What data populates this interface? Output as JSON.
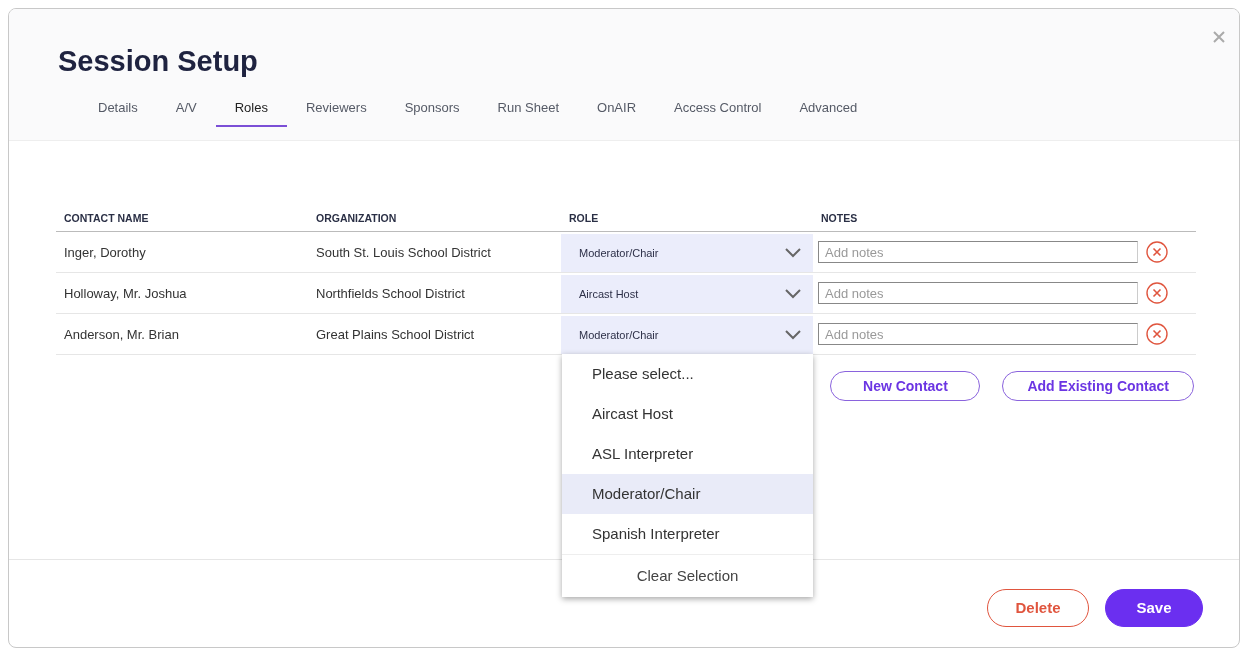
{
  "dialog": {
    "title": "Session Setup"
  },
  "tabs": [
    {
      "label": "Details",
      "selected": false
    },
    {
      "label": "A/V",
      "selected": false
    },
    {
      "label": "Roles",
      "selected": true
    },
    {
      "label": "Reviewers",
      "selected": false
    },
    {
      "label": "Sponsors",
      "selected": false
    },
    {
      "label": "Run Sheet",
      "selected": false
    },
    {
      "label": "OnAIR",
      "selected": false
    },
    {
      "label": "Access Control",
      "selected": false
    },
    {
      "label": "Advanced",
      "selected": false
    }
  ],
  "table": {
    "columns": [
      "CONTACT NAME",
      "ORGANIZATION",
      "ROLE",
      "NOTES"
    ],
    "rows": [
      {
        "name": "Inger, Dorothy",
        "organization": "South St. Louis School District",
        "role": "Moderator/Chair",
        "notes_placeholder": "Add notes",
        "dropdown_open": false
      },
      {
        "name": "Holloway, Mr. Joshua",
        "organization": "Northfields School District",
        "role": "Aircast Host",
        "notes_placeholder": "Add notes",
        "dropdown_open": false
      },
      {
        "name": "Anderson, Mr. Brian",
        "organization": "Great Plains School District",
        "role": "Moderator/Chair",
        "notes_placeholder": "Add notes",
        "dropdown_open": true
      }
    ]
  },
  "role_menu": {
    "options": [
      {
        "label": "Please select...",
        "selected": false
      },
      {
        "label": "Aircast Host",
        "selected": false
      },
      {
        "label": "ASL Interpreter",
        "selected": false
      },
      {
        "label": "Moderator/Chair",
        "selected": true
      },
      {
        "label": "Spanish Interpreter",
        "selected": false
      }
    ],
    "clear": "Clear Selection"
  },
  "contact_buttons": [
    "New Contact",
    "Add Existing Contact"
  ],
  "footer_buttons": [
    {
      "label": "Delete",
      "kind": "danger"
    },
    {
      "label": "Save",
      "kind": "primary"
    }
  ]
}
